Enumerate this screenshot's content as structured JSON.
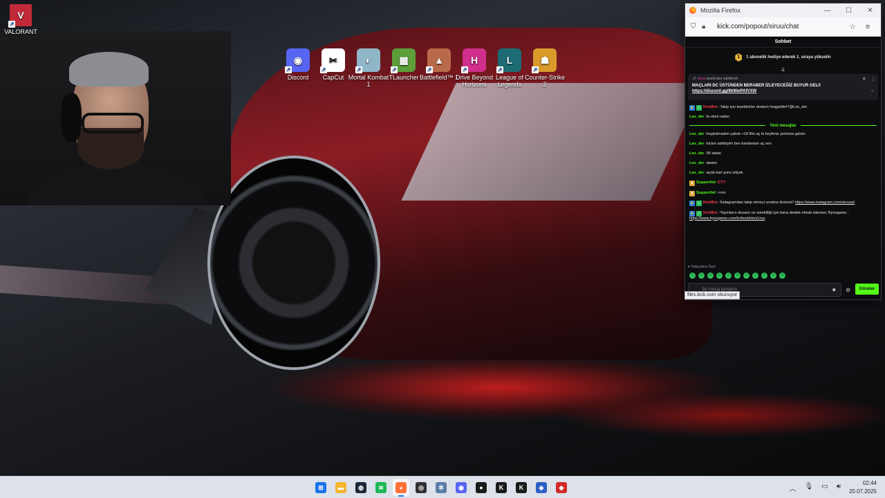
{
  "desktop": {
    "valorant_label": "VALORANT",
    "icons": [
      {
        "label": "Discord",
        "icon": "discord-icon",
        "color": "#5865f2",
        "glyph": "◉"
      },
      {
        "label": "CapCut",
        "icon": "capcut-icon",
        "color": "#ffffff",
        "glyph": "✂"
      },
      {
        "label": "Mortal Kombat 1",
        "icon": "mortal-kombat-icon",
        "color": "#8fb7c8",
        "glyph": "◐"
      },
      {
        "label": "TLauncher",
        "icon": "tlauncher-icon",
        "color": "#5c9e3a",
        "glyph": "▦"
      },
      {
        "label": "Battlefield™ 1",
        "icon": "battlefield-icon",
        "color": "#b86a4a",
        "glyph": "▲"
      },
      {
        "label": "Drive Beyond Horizons",
        "icon": "drive-beyond-horizons-icon",
        "color": "#d0308c",
        "glyph": "H"
      },
      {
        "label": "League of Legends",
        "icon": "league-of-legends-icon",
        "color": "#1d6c74",
        "glyph": "L"
      },
      {
        "label": "Counter-Strike 2",
        "icon": "counter-strike-icon",
        "color": "#d99a2a",
        "glyph": "☗"
      }
    ]
  },
  "browser": {
    "title": "Mozilla Firefox",
    "url": "kick.com/popout/siruu/chat",
    "status": "files.kick.com okunuyor"
  },
  "chat": {
    "header": "Sohbet",
    "sub_banner": "1 abonelik hediye ederek 1. sıraya yükselin",
    "sub_badge": "1",
    "pinned": {
      "by_name": "Siruu",
      "by_text": "tarafından sabitlendi",
      "text": "MAÇLARI DC ÜSTÜNDEN BERABER İZLEYECEĞİZ BUYUR GELI!",
      "link": "https://discord.gg/9bWwPAfVXW"
    },
    "messages_before": [
      {
        "badges": [
          "bot",
          "verified"
        ],
        "user": "KickBot",
        "user_class": "u-red",
        "text": "Takip için teşekkürler dostum hoşgeldin!!!@Leo_der"
      },
      {
        "badges": [],
        "user": "Leo_der",
        "user_class": "u-green",
        "text": "la olum naber"
      }
    ],
    "divider": "Yeni mesajlar",
    "messages_after": [
      {
        "badges": [],
        "user": "Leo_der",
        "user_class": "u-green",
        "text": "hoşbulmadım çabuk +18 film aç bi keyfimiz yerimize gelsin"
      },
      {
        "badges": [],
        "user": "Leo_der",
        "user_class": "u-green",
        "text": "kickin sahibiyim ben banlamam aç sen"
      },
      {
        "badges": [],
        "user": "Leo_der",
        "user_class": "u-green",
        "text": "99 atsan"
      },
      {
        "badges": [],
        "user": "Leo_der",
        "user_class": "u-green",
        "text": "atsam"
      },
      {
        "badges": [],
        "user": "Leo_der",
        "user_class": "u-green",
        "text": "açda bari şunu izliyek"
      },
      {
        "badges": [
          "sub"
        ],
        "user": "Supporthd",
        "user_class": "u-green",
        "text": "CTY",
        "text_class": "red"
      },
      {
        "badges": [
          "sub"
        ],
        "user": "Supporthd",
        "user_class": "u-green",
        "text": "+rnn"
      },
      {
        "badges": [
          "bot",
          "verified"
        ],
        "user": "KickBot",
        "user_class": "u-red",
        "text": "İnstagramdan takip etmeyi unutma dostum!!",
        "link": "https://www.instagram.com/sirruuw/"
      },
      {
        "badges": [
          "bot",
          "verified"
        ],
        "user": "KickBot",
        "user_class": "u-red",
        "text": "Yayınların devamı ve sürekliliği için bana destek olmak istersen; Bynogame :",
        "link": "https://www.bynogame.com/tr/destekle/s1ruu"
      }
    ],
    "followers_label": "Takipçilere Özel",
    "emote_count_label": "11",
    "input_placeholder": "Bir mesaj gönderin",
    "send_label": "Gönder"
  },
  "taskbar": {
    "apps": [
      {
        "name": "start-button",
        "glyph": "⊞",
        "color": "#1a73e8"
      },
      {
        "name": "file-explorer-icon",
        "glyph": "▬",
        "color": "#f2b632"
      },
      {
        "name": "steam-icon",
        "glyph": "◍",
        "color": "#1b2838"
      },
      {
        "name": "spotify-icon",
        "glyph": "≋",
        "color": "#1db954"
      },
      {
        "name": "firefox-icon",
        "glyph": "◕",
        "color": "#ff7139",
        "active": true
      },
      {
        "name": "obs-icon",
        "glyph": "◎",
        "color": "#302e31"
      },
      {
        "name": "settings-icon",
        "glyph": "✲",
        "color": "#5a7ea8"
      },
      {
        "name": "discord-taskbar-icon",
        "glyph": "◉",
        "color": "#5865f2"
      },
      {
        "name": "app-black-icon",
        "glyph": "●",
        "color": "#1a1a1a"
      },
      {
        "name": "kick-icon",
        "glyph": "K",
        "color": "#1a1a1a"
      },
      {
        "name": "kick-studio-icon",
        "glyph": "K",
        "color": "#1a1a1a"
      },
      {
        "name": "edge-like-icon",
        "glyph": "◈",
        "color": "#2d5fc4"
      },
      {
        "name": "red-app-icon",
        "glyph": "◆",
        "color": "#d32a2a"
      }
    ],
    "time": "02:44",
    "date": "20.07.2025"
  }
}
